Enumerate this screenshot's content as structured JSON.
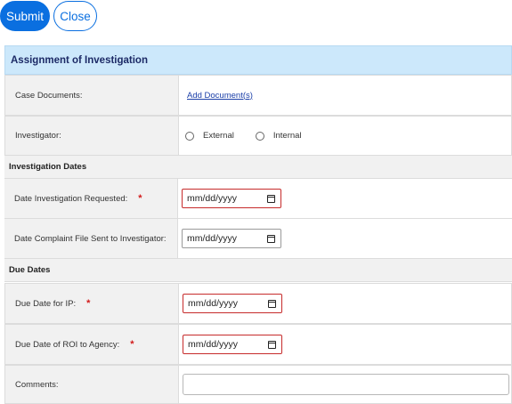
{
  "toolbar": {
    "submit_label": "Submit",
    "close_label": "Close"
  },
  "form": {
    "title": "Assignment of Investigation",
    "case_documents": {
      "label": "Case Documents:",
      "link": "Add Document(s)"
    },
    "investigator": {
      "label": "Investigator:",
      "options": [
        "External",
        "Internal"
      ]
    },
    "section_investigation_dates": "Investigation Dates",
    "date_requested": {
      "label": "Date Investigation Requested:",
      "required_mark": "*",
      "placeholder": "mm/dd/yyyy"
    },
    "date_sent": {
      "label": "Date Complaint File Sent to Investigator:",
      "placeholder": "mm/dd/yyyy"
    },
    "section_due_dates": "Due Dates",
    "due_ip": {
      "label": "Due Date for IP:",
      "required_mark": "*",
      "placeholder": "mm/dd/yyyy"
    },
    "due_roi": {
      "label": "Due Date of ROI to Agency:",
      "required_mark": "*",
      "placeholder": "mm/dd/yyyy"
    },
    "comments": {
      "label": "Comments:",
      "value": ""
    }
  },
  "colors": {
    "accent": "#0a6fe0",
    "header_bg": "#cce8fb",
    "required": "#d21a1a"
  },
  "icons": {
    "date_picker": "calendar-icon",
    "radio": "radio-unchecked"
  }
}
